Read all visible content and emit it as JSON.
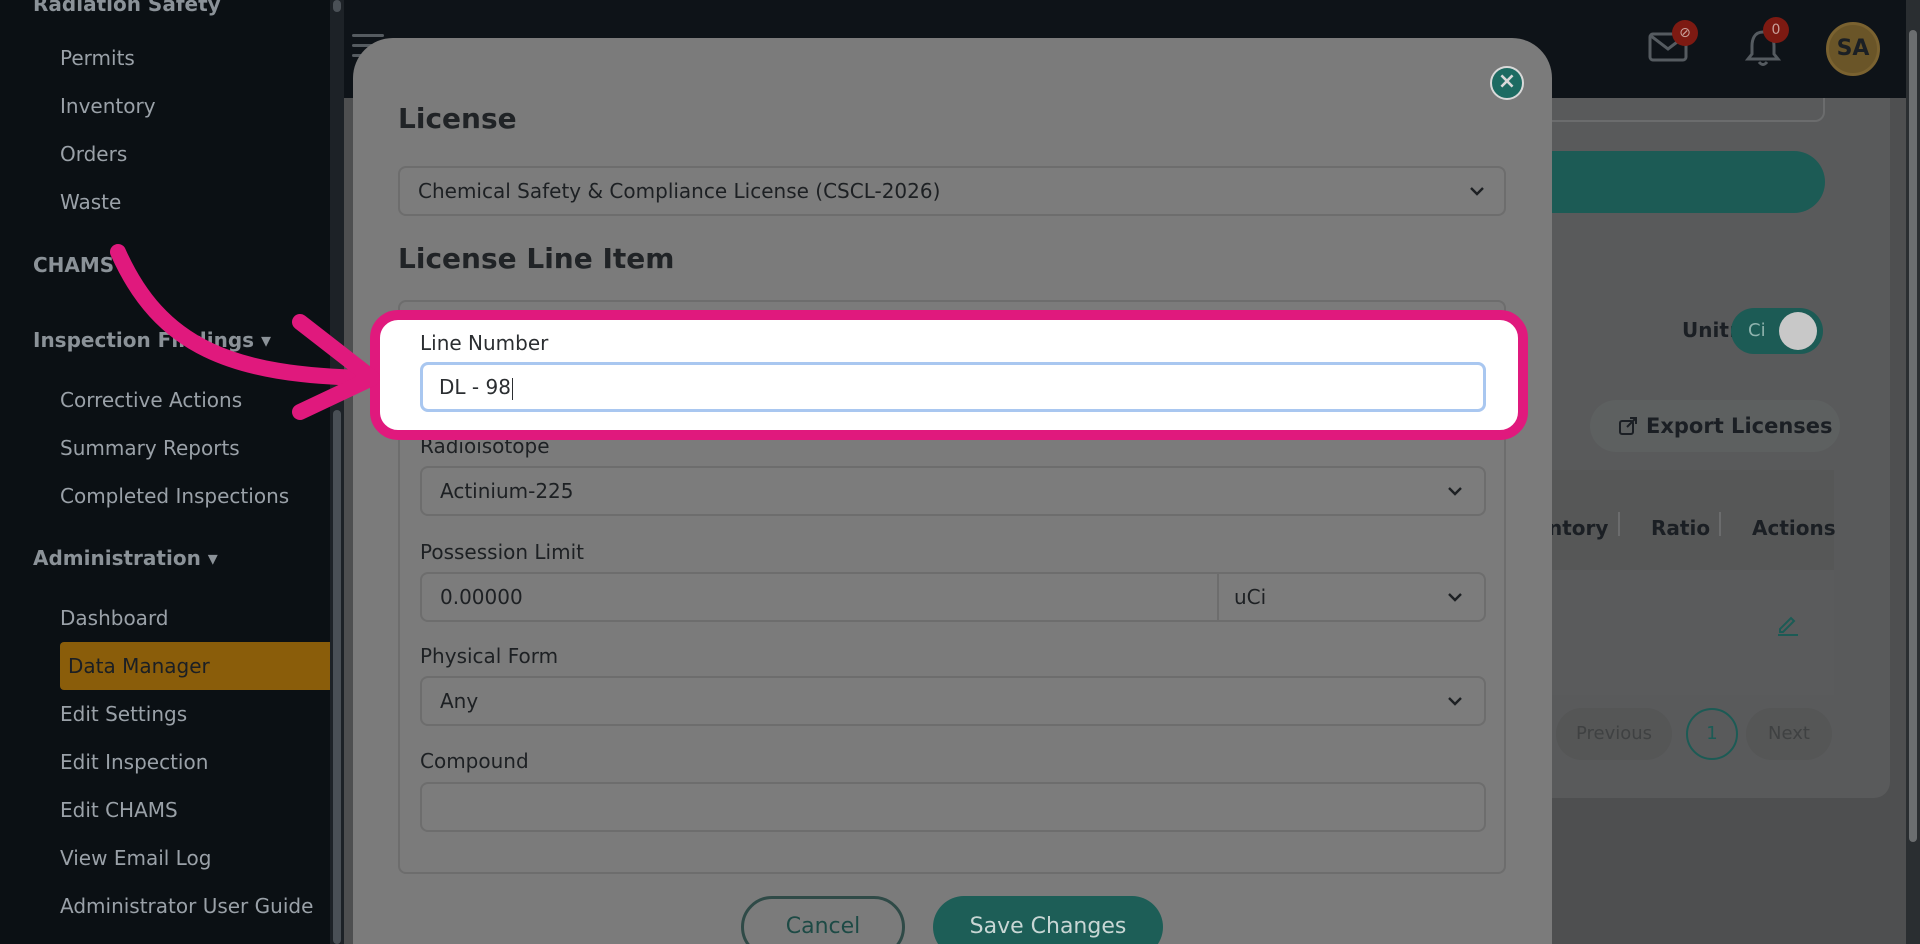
{
  "sidebar": {
    "top_section_partial": "Radiation Safety",
    "radiation_items": [
      "Permits",
      "Inventory",
      "Orders",
      "Waste"
    ],
    "chams": "CHAMS",
    "inspection_findings": "Inspection Findings",
    "inspection_items": [
      "Corrective Actions",
      "Summary Reports",
      "Completed Inspections"
    ],
    "administration": "Administration",
    "admin_items": [
      "Dashboard",
      "Data Manager",
      "Edit Settings",
      "Edit Inspection",
      "Edit CHAMS",
      "View Email Log",
      "Administrator User Guide"
    ],
    "active_item": "Data Manager"
  },
  "topbar": {
    "notifications_count": "0",
    "avatar_initials": "SA"
  },
  "background": {
    "unit_label": "Unit:",
    "unit_value": "Ci",
    "export_label": "Export Licenses",
    "table_headers": [
      "ntory",
      "Ratio",
      "Actions"
    ],
    "pagination": {
      "previous": "Previous",
      "page": "1",
      "next": "Next"
    }
  },
  "modal": {
    "license_heading": "License",
    "license_selected": "Chemical Safety & Compliance License (CSCL-2026)",
    "line_item_heading": "License Line Item",
    "line_number_label": "Line Number",
    "line_number_value": "DL - 98",
    "radioisotope_label": "Radioisotope",
    "radioisotope_value": "Actinium-225",
    "possession_limit_label": "Possession Limit",
    "possession_limit_value": "0.00000",
    "possession_unit_value": "uCi",
    "physical_form_label": "Physical Form",
    "physical_form_value": "Any",
    "compound_label": "Compound",
    "compound_value": "",
    "cancel_label": "Cancel",
    "save_label": "Save Changes"
  },
  "colors": {
    "highlight": "#e0197d",
    "teal": "#1d5e57",
    "active_nav": "#8a5d0a"
  }
}
